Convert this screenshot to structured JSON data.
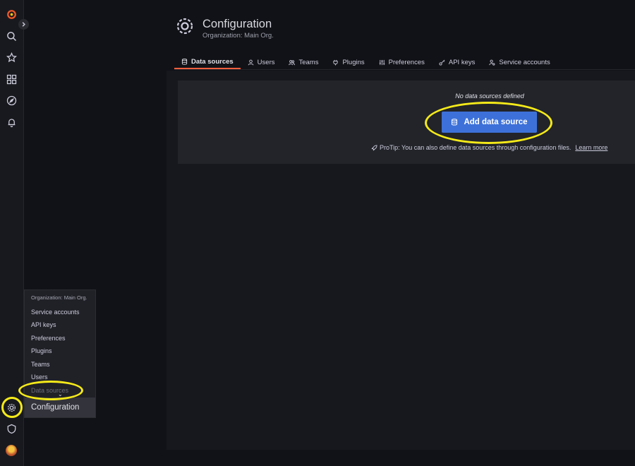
{
  "header": {
    "title": "Configuration",
    "subtitle": "Organization: Main Org."
  },
  "tabs": [
    {
      "label": "Data sources",
      "icon": "database-icon",
      "active": true
    },
    {
      "label": "Users",
      "icon": "user-icon",
      "active": false
    },
    {
      "label": "Teams",
      "icon": "users-icon",
      "active": false
    },
    {
      "label": "Plugins",
      "icon": "plug-icon",
      "active": false
    },
    {
      "label": "Preferences",
      "icon": "sliders-icon",
      "active": false
    },
    {
      "label": "API keys",
      "icon": "key-icon",
      "active": false
    },
    {
      "label": "Service accounts",
      "icon": "user-cog-icon",
      "active": false
    }
  ],
  "empty_state": {
    "title": "No data sources defined",
    "button_label": "Add data source",
    "protip": "ProTip: You can also define data sources through configuration files.",
    "learn_more": "Learn more"
  },
  "flyout": {
    "header": "Organization: Main Org.",
    "items": [
      "Service accounts",
      "API keys",
      "Preferences",
      "Plugins",
      "Teams",
      "Users",
      "Data sources"
    ],
    "title": "Configuration"
  },
  "colors": {
    "accent_primary": "#3d71d9",
    "tab_active_underline": "#f55f3e",
    "highlight": "#f5ea19",
    "background": "#111217"
  }
}
